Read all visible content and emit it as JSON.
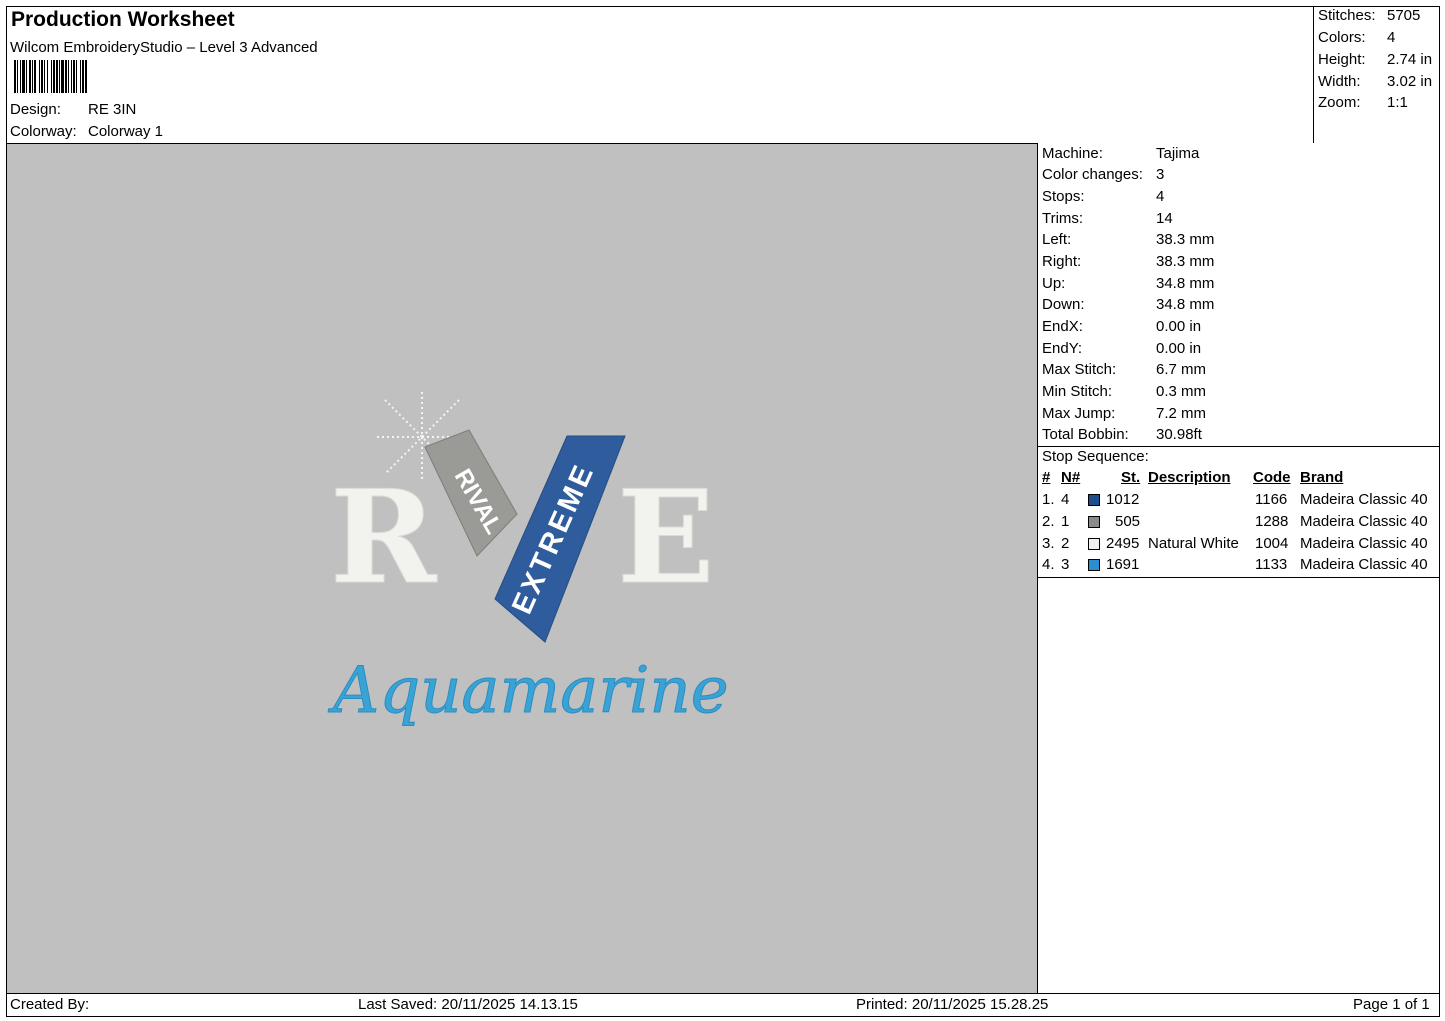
{
  "header": {
    "title": "Production Worksheet",
    "software": "Wilcom EmbroideryStudio – Level 3 Advanced",
    "design_label": "Design:",
    "design_value": "RE 3IN",
    "colorway_label": "Colorway:",
    "colorway_value": "Colorway 1"
  },
  "stats": [
    {
      "label": "Stitches:",
      "value": "5705"
    },
    {
      "label": "Colors:",
      "value": "4"
    },
    {
      "label": "Height:",
      "value": "2.74 in"
    },
    {
      "label": "Width:",
      "value": "3.02 in"
    },
    {
      "label": "Zoom:",
      "value": "1:1"
    }
  ],
  "specs": [
    {
      "label": "Machine:",
      "value": "Tajima"
    },
    {
      "label": "Color changes:",
      "value": "3"
    },
    {
      "label": "Stops:",
      "value": "4"
    },
    {
      "label": "Trims:",
      "value": "14"
    },
    {
      "label": "Left:",
      "value": "38.3 mm"
    },
    {
      "label": "Right:",
      "value": "38.3 mm"
    },
    {
      "label": "Up:",
      "value": "34.8 mm"
    },
    {
      "label": "Down:",
      "value": "34.8 mm"
    },
    {
      "label": "EndX:",
      "value": "0.00 in"
    },
    {
      "label": "EndY:",
      "value": "0.00 in"
    },
    {
      "label": "Max Stitch:",
      "value": "6.7 mm"
    },
    {
      "label": "Min Stitch:",
      "value": "0.3 mm"
    },
    {
      "label": "Max Jump:",
      "value": "7.2 mm"
    },
    {
      "label": "Total Bobbin:",
      "value": "30.98ft"
    }
  ],
  "sequence": {
    "title": "Stop Sequence:",
    "headers": {
      "num": "#",
      "n": "N#",
      "st": "St.",
      "desc": "Description",
      "code": "Code",
      "brand": "Brand"
    },
    "rows": [
      {
        "num": "1.",
        "n": "4",
        "color": "#1f4e8c",
        "st": "1012",
        "desc": "",
        "code": "1166",
        "brand": "Madeira Classic 40"
      },
      {
        "num": "2.",
        "n": "1",
        "color": "#8a8a8a",
        "st": "505",
        "desc": "",
        "code": "1288",
        "brand": "Madeira Classic 40"
      },
      {
        "num": "3.",
        "n": "2",
        "color": "#f0f0f0",
        "st": "2495",
        "desc": "Natural White",
        "code": "1004",
        "brand": "Madeira Classic 40"
      },
      {
        "num": "4.",
        "n": "3",
        "color": "#2a8fd0",
        "st": "1691",
        "desc": "",
        "code": "1133",
        "brand": "Madeira Classic 40"
      }
    ]
  },
  "design_art": {
    "letter_left": "R",
    "letter_right": "E",
    "banner_small": "RIVAL",
    "banner_large": "EXTREME",
    "script_text": "Aquamarine",
    "colors": {
      "white": "#f2f2ee",
      "grey": "#9a9a96",
      "navy": "#2f5c9c",
      "aqua": "#3aa3d6",
      "background": "#c0c0c0"
    }
  },
  "footer": {
    "created": "Created By:",
    "saved": "Last Saved: 20/11/2025 14.13.15",
    "printed": "Printed: 20/11/2025 15.28.25",
    "page": "Page 1 of 1"
  }
}
